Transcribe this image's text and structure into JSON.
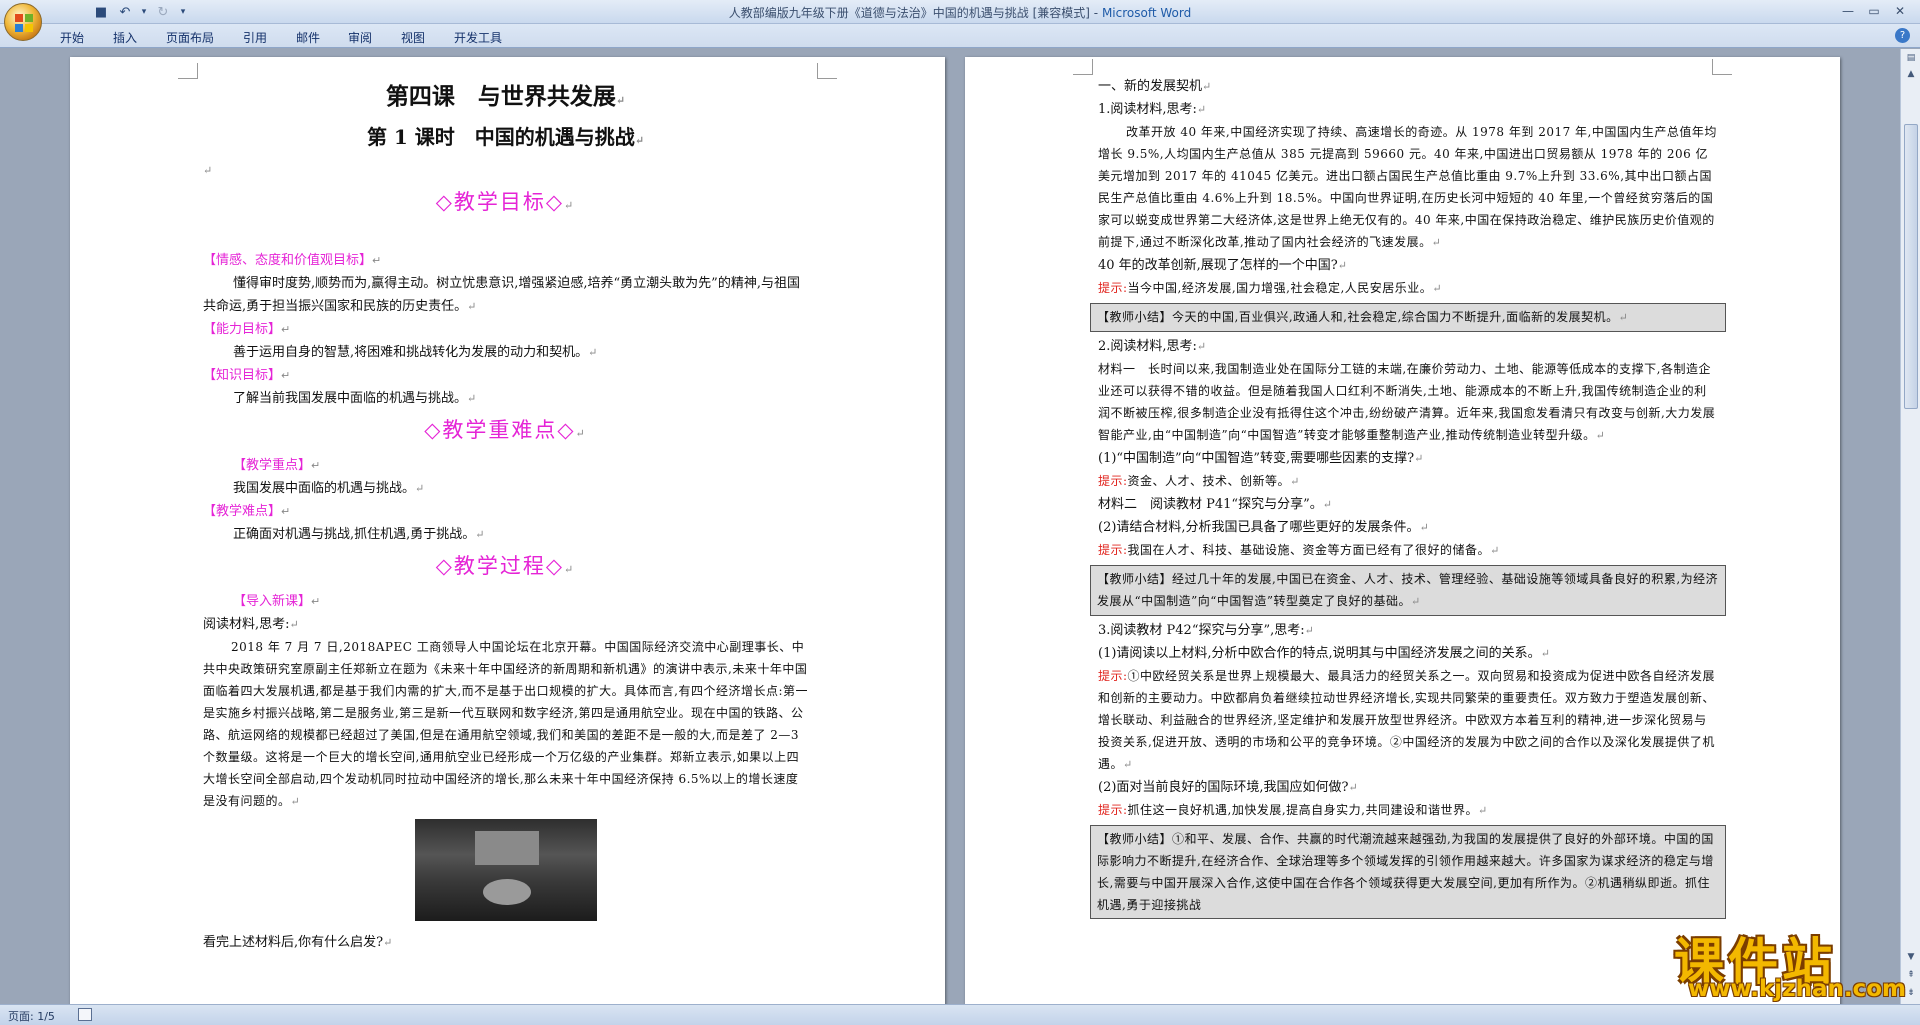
{
  "window": {
    "title_doc": "人教部编版九年级下册《道德与法治》中国的机遇与挑战 [兼容模式]",
    "title_sep": " - ",
    "title_app": "Microsoft Word"
  },
  "ribbon_tabs": [
    "开始",
    "插入",
    "页面布局",
    "引用",
    "邮件",
    "审阅",
    "视图",
    "开发工具"
  ],
  "status": {
    "page": "页面: 1/5"
  },
  "watermark": {
    "brand": "课件站",
    "url": "www.kjzhan.com"
  },
  "page1": {
    "lesson_title": "第四课　与世界共发展",
    "lesson_subtitle": "第 1 课时　中国的机遇与挑战",
    "objectives_heading": "◇教学目标◇",
    "emotion_label": "【情感、态度和价值观目标】",
    "emotion_text": "懂得审时度势,顺势而为,赢得主动。树立忧患意识,增强紧迫感,培养“勇立潮头敢为先”的精神,与祖国共命运,勇于担当振兴国家和民族的历史责任。",
    "ability_label": "【能力目标】",
    "ability_text": "善于运用自身的智慧,将困难和挑战转化为发展的动力和契机。",
    "knowledge_label": "【知识目标】",
    "knowledge_text": "了解当前我国发展中面临的机遇与挑战。",
    "difficulty_heading": "◇教学重难点◇",
    "focus_label": "【教学重点】",
    "focus_text": "我国发展中面临的机遇与挑战。",
    "hard_label": "【教学难点】",
    "hard_text": "正确面对机遇与挑战,抓住机遇,勇于挑战。",
    "process_heading": "◇教学过程◇",
    "intro_label": "【导入新课】",
    "read_prompt": "阅读材料,思考:",
    "material": "2018 年 7 月 7 日,2018APEC 工商领导人中国论坛在北京开幕。中国国际经济交流中心副理事长、中共中央政策研究室原副主任郑新立在题为《未来十年中国经济的新周期和新机遇》的演讲中表示,未来十年中国面临着四大发展机遇,都是基于我们内需的扩大,而不是基于出口规模的扩大。具体而言,有四个经济增长点:第一是实施乡村振兴战略,第二是服务业,第三是新一代互联网和数字经济,第四是通用航空业。现在中国的铁路、公路、航运网络的规模都已经超过了美国,但是在通用航空领域,我们和美国的差距不是一般的大,而是差了 2—3 个数量级。这将是一个巨大的增长空间,通用航空业已经形成一个万亿级的产业集群。郑新立表示,如果以上四大增长空间全部启动,四个发动机同时拉动中国经济的增长,那么未来十年中国经济保持 6.5%以上的增长速度是没有问题的。",
    "question": "看完上述材料后,你有什么启发?"
  },
  "page2": {
    "section": "一、新的发展契机",
    "q1_title": "1.阅读材料,思考:",
    "q1_material": "改革开放 40 年来,中国经济实现了持续、高速增长的奇迹。从 1978 年到 2017 年,中国国内生产总值年均增长 9.5%,人均国内生产总值从 385 元提高到 59660 元。40 年来,中国进出口贸易额从 1978 年的 206 亿美元增加到 2017 年的 41045 亿美元。进出口额占国民生产总值比重由 9.7%上升到 33.6%,其中出口额占国民生产总值比重由 4.6%上升到 18.5%。中国向世界证明,在历史长河中短短的 40 年里,一个曾经贫穷落后的国家可以蜕变成世界第二大经济体,这是世界上绝无仅有的。40 年来,中国在保持政治稳定、维护民族历史价值观的前提下,通过不断深化改革,推动了国内社会经济的飞速发展。",
    "q1_question": "40 年的改革创新,展现了怎样的一个中国?",
    "tip_label": "提示:",
    "q1_tip": "当今中国,经济发展,国力增强,社会稳定,人民安居乐业。",
    "summary_label": "【教师小结】",
    "summary1": "今天的中国,百业俱兴,政通人和,社会稳定,综合国力不断提升,面临新的发展契机。",
    "q2_title": "2.阅读材料,思考:",
    "q2_material_label": "材料一　",
    "q2_material": "长时间以来,我国制造业处在国际分工链的末端,在廉价劳动力、土地、能源等低成本的支撑下,各制造企业还可以获得不错的收益。但是随着我国人口红利不断消失,土地、能源成本的不断上升,我国传统制造企业的利润不断被压榨,很多制造企业没有抵得住这个冲击,纷纷破产清算。近年来,我国愈发看清只有改变与创新,大力发展智能产业,由“中国制造”向“中国智造”转变才能够重整制造产业,推动传统制造业转型升级。",
    "q2_sub1": "(1)“中国制造”向“中国智造”转变,需要哪些因素的支撑?",
    "q2_tip1": "资金、人才、技术、创新等。",
    "q2_material2": "材料二　阅读教材 P41“探究与分享”。",
    "q2_sub2": "(2)请结合材料,分析我国已具备了哪些更好的发展条件。",
    "q2_tip2": "我国在人才、科技、基础设施、资金等方面已经有了很好的储备。",
    "summary2": "经过几十年的发展,中国已在资金、人才、技术、管理经验、基础设施等领域具备良好的积累,为经济发展从“中国制造”向“中国智造”转型奠定了良好的基础。",
    "q3_title": "3.阅读教材 P42“探究与分享”,思考:",
    "q3_sub1": "(1)请阅读以上材料,分析中欧合作的特点,说明其与中国经济发展之间的关系。",
    "q3_tip1": "①中欧经贸关系是世界上规模最大、最具活力的经贸关系之一。双向贸易和投资成为促进中欧各自经济发展和创新的主要动力。中欧都肩负着继续拉动世界经济增长,实现共同繁荣的重要责任。双方致力于塑造发展创新、增长联动、利益融合的世界经济,坚定维护和发展开放型世界经济。中欧双方本着互利的精神,进一步深化贸易与投资关系,促进开放、透明的市场和公平的竞争环境。②中国经济的发展为中欧之间的合作以及深化发展提供了机遇。",
    "q3_sub2": "(2)面对当前良好的国际环境,我国应如何做?",
    "q3_tip2": "抓住这一良好机遇,加快发展,提高自身实力,共同建设和谐世界。",
    "summary3": "①和平、发展、合作、共赢的时代潮流越来越强劲,为我国的发展提供了良好的外部环境。中国的国际影响力不断提升,在经济合作、全球治理等多个领域发挥的引领作用越来越大。许多国家为谋求经济的稳定与增长,需要与中国开展深入合作,这使中国在合作各个领域获得更大发展空间,更加有所作为。②机遇稍纵即逝。抓住机遇,勇于迎接挑战"
  }
}
